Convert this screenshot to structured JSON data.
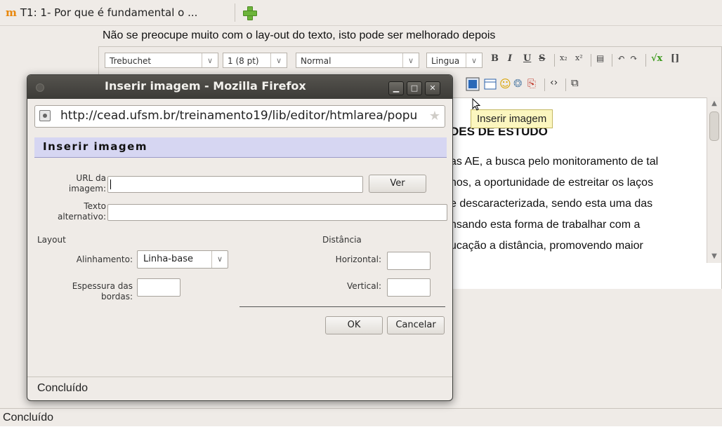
{
  "browser": {
    "tab_title": "T1: 1- Por que é fundamental o ...",
    "status": "Concluído"
  },
  "editor": {
    "hint": "Não se preocupe muito com o lay-out do texto, isto pode ser melhorado depois",
    "font_family": "Trebuchet",
    "font_size": "1 (8 pt)",
    "format": "Normal",
    "language": "Lingua",
    "content_lines": [
      "DES DE ESTUDO",
      "as AE, a busca pelo monitoramento de tal",
      "nos, a oportunidade de estreitar os laços",
      "e descaracterizada, sendo esta uma das",
      "nsando esta forma de trabalhar com a",
      "ucação a distância, promovendo maior"
    ],
    "tooltip": "Inserir imagem"
  },
  "dialog": {
    "window_title": "Inserir imagem - Mozilla Firefox",
    "url": "http://cead.ufsm.br/treinamento19/lib/editor/htmlarea/popu",
    "header": "Inserir imagem",
    "url_label_1": "URL da",
    "url_label_2": "imagem:",
    "ver_button": "Ver",
    "alt_label_1": "Texto",
    "alt_label_2": "alternativo:",
    "layout_label": "Layout",
    "alignment_label": "Alinhamento:",
    "alignment_value": "Linha-base",
    "border_label_1": "Espessura das",
    "border_label_2": "bordas:",
    "spacing_label": "Distância",
    "horizontal_label": "Horizontal:",
    "vertical_label": "Vertical:",
    "ok_button": "OK",
    "cancel_button": "Cancelar",
    "status": "Concluído"
  },
  "colors": {
    "dialog_header_bg": "#d6d6f2",
    "tooltip_bg": "#fbf6bf",
    "titlebar": "#3c3b37"
  }
}
